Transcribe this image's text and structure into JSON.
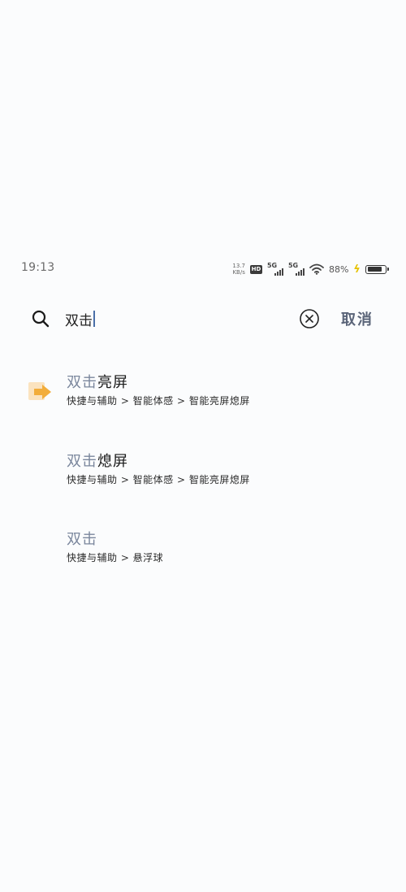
{
  "status_bar": {
    "time": "19:13",
    "net_speed_value": "13.7",
    "net_speed_unit": "KB/s",
    "hd_label": "HD",
    "sim1_label": "5G",
    "sim2_label": "5G",
    "battery_percent": "88%",
    "battery_level": 0.88
  },
  "search": {
    "query": "双击",
    "cancel_label": "取消"
  },
  "results": [
    {
      "title_match": "双击",
      "title_rest": "亮屏",
      "path": "快捷与辅助 > 智能体感 > 智能亮屏熄屏",
      "icon": "quick-assist-arrow-icon",
      "icon_colors": {
        "back": "#fbe3bf",
        "arrow": "#f2ad3b"
      }
    },
    {
      "title_match": "双击",
      "title_rest": "熄屏",
      "path": "快捷与辅助 > 智能体感 > 智能亮屏熄屏"
    },
    {
      "title_match": "双击",
      "title_rest": "",
      "path": "快捷与辅助 > 悬浮球"
    }
  ],
  "colors": {
    "highlight": "#7b879d",
    "cancel": "#5a6478",
    "caret": "#4a6fa8"
  }
}
